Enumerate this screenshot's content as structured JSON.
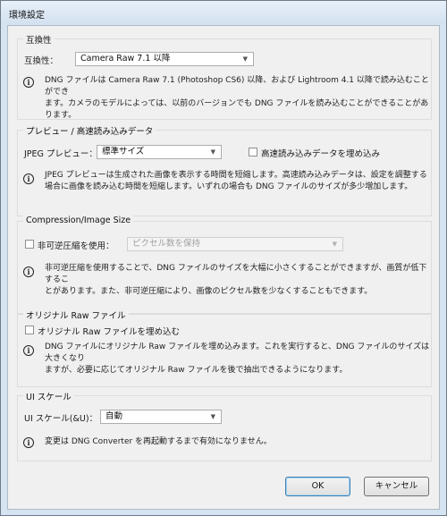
{
  "window": {
    "title": "環境設定"
  },
  "compat": {
    "legend": "互換性",
    "label": "互換性：",
    "value": "Camera Raw 7.1 以降",
    "desc": [
      "DNG ファイルは Camera Raw 7.1 (Photoshop CS6) 以降、および Lightroom 4.1 以降で読み込むことができ",
      "ます。カメラのモデルによっては、以前のバージョンでも DNG ファイルを読み込むことができることがあります。"
    ]
  },
  "preview": {
    "legend": "プレビュー / 高速読み込みデータ",
    "label": "JPEG プレビュー：",
    "value": "標準サイズ",
    "fastload_label": "高速読み込みデータを埋め込み",
    "desc": [
      "JPEG プレビューは生成された画像を表示する時間を短縮します。高速読み込みデータは、設定を調整する",
      "場合に画像を読み込む時間を短縮します。いずれの場合も DNG ファイルのサイズが多少増加します。"
    ]
  },
  "compression": {
    "legend": "Compression/Image Size",
    "lossy_label": "非可逆圧縮を使用：",
    "value": "ピクセル数を保持",
    "desc": [
      "非可逆圧縮を使用することで、DNG ファイルのサイズを大幅に小さくすることができますが、画質が低下するこ",
      "とがあります。また、非可逆圧縮により、画像のピクセル数を少なくすることもできます。"
    ]
  },
  "original": {
    "legend": "オリジナル Raw ファイル",
    "embed_label": "オリジナル Raw ファイルを埋め込む",
    "desc": [
      "DNG ファイルにオリジナル Raw ファイルを埋め込みます。これを実行すると、DNG ファイルのサイズは大きくなり",
      "ますが、必要に応じてオリジナル Raw ファイルを後で抽出できるようになります。"
    ]
  },
  "ui_scale": {
    "legend": "UI スケール",
    "label": "UI スケール(&U)：",
    "value": "自動",
    "desc": "変更は DNG Converter を再起動するまで有効になりません。"
  },
  "buttons": {
    "ok": "OK",
    "cancel": "キャンセル"
  },
  "icons": {
    "dropdown": "chevron-down-icon",
    "info": "info-icon"
  }
}
